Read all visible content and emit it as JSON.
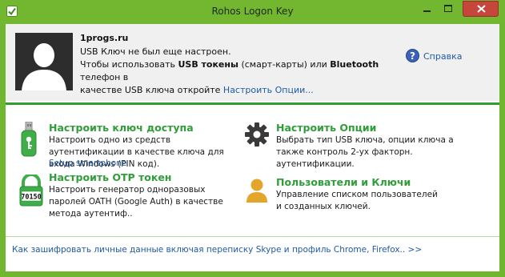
{
  "window": {
    "title": "Rohos Logon Key",
    "controls": {
      "minimize": "minimize",
      "maximize": "maximize",
      "close": "close"
    }
  },
  "header": {
    "account_name": "1progs.ru",
    "status_line1": "USB Ключ не был еще настроен.",
    "status_line2_a": "Чтобы использовать ",
    "status_line2_b": "USB токены",
    "status_line2_c": " (смарт-карты) или ",
    "status_line2_d": "Bluetooth",
    "status_line2_e": " телефон в",
    "status_line3_a": "качестве USB ключа откройте ",
    "status_line3_link": "Настроить Опции...",
    "help_label": "Справка"
  },
  "tiles": {
    "access_key": {
      "title": "Настроить ключ доступа",
      "desc": "Настроить одно из средств аутентификации в качестве ключа для входа Windows (PIN код).",
      "sub_link": "Setup smartphone"
    },
    "options": {
      "title": "Настроить Опции",
      "desc": "Выбрать тип USB ключа, опции ключа а также контроль 2-ух факторн. аутентификации."
    },
    "otp": {
      "title": "Настроить OTP токен",
      "desc": "Настроить генератор одноразовых паролей OATH (Google Auth) в качестве метода аутентиф..",
      "token_digits": "70150"
    },
    "users": {
      "title": "Пользователи и Ключи",
      "desc": "Управление списком пользователей и созданных ключей."
    }
  },
  "footer": {
    "link": "Как зашифровать личные данные включая переписку Skype и профиль Chrome, Firefox..  >>"
  },
  "colors": {
    "titlebar": "#73b730",
    "accent_green": "#2f9e3a",
    "link_blue": "#1f5aa6",
    "close_red": "#c7463c"
  }
}
